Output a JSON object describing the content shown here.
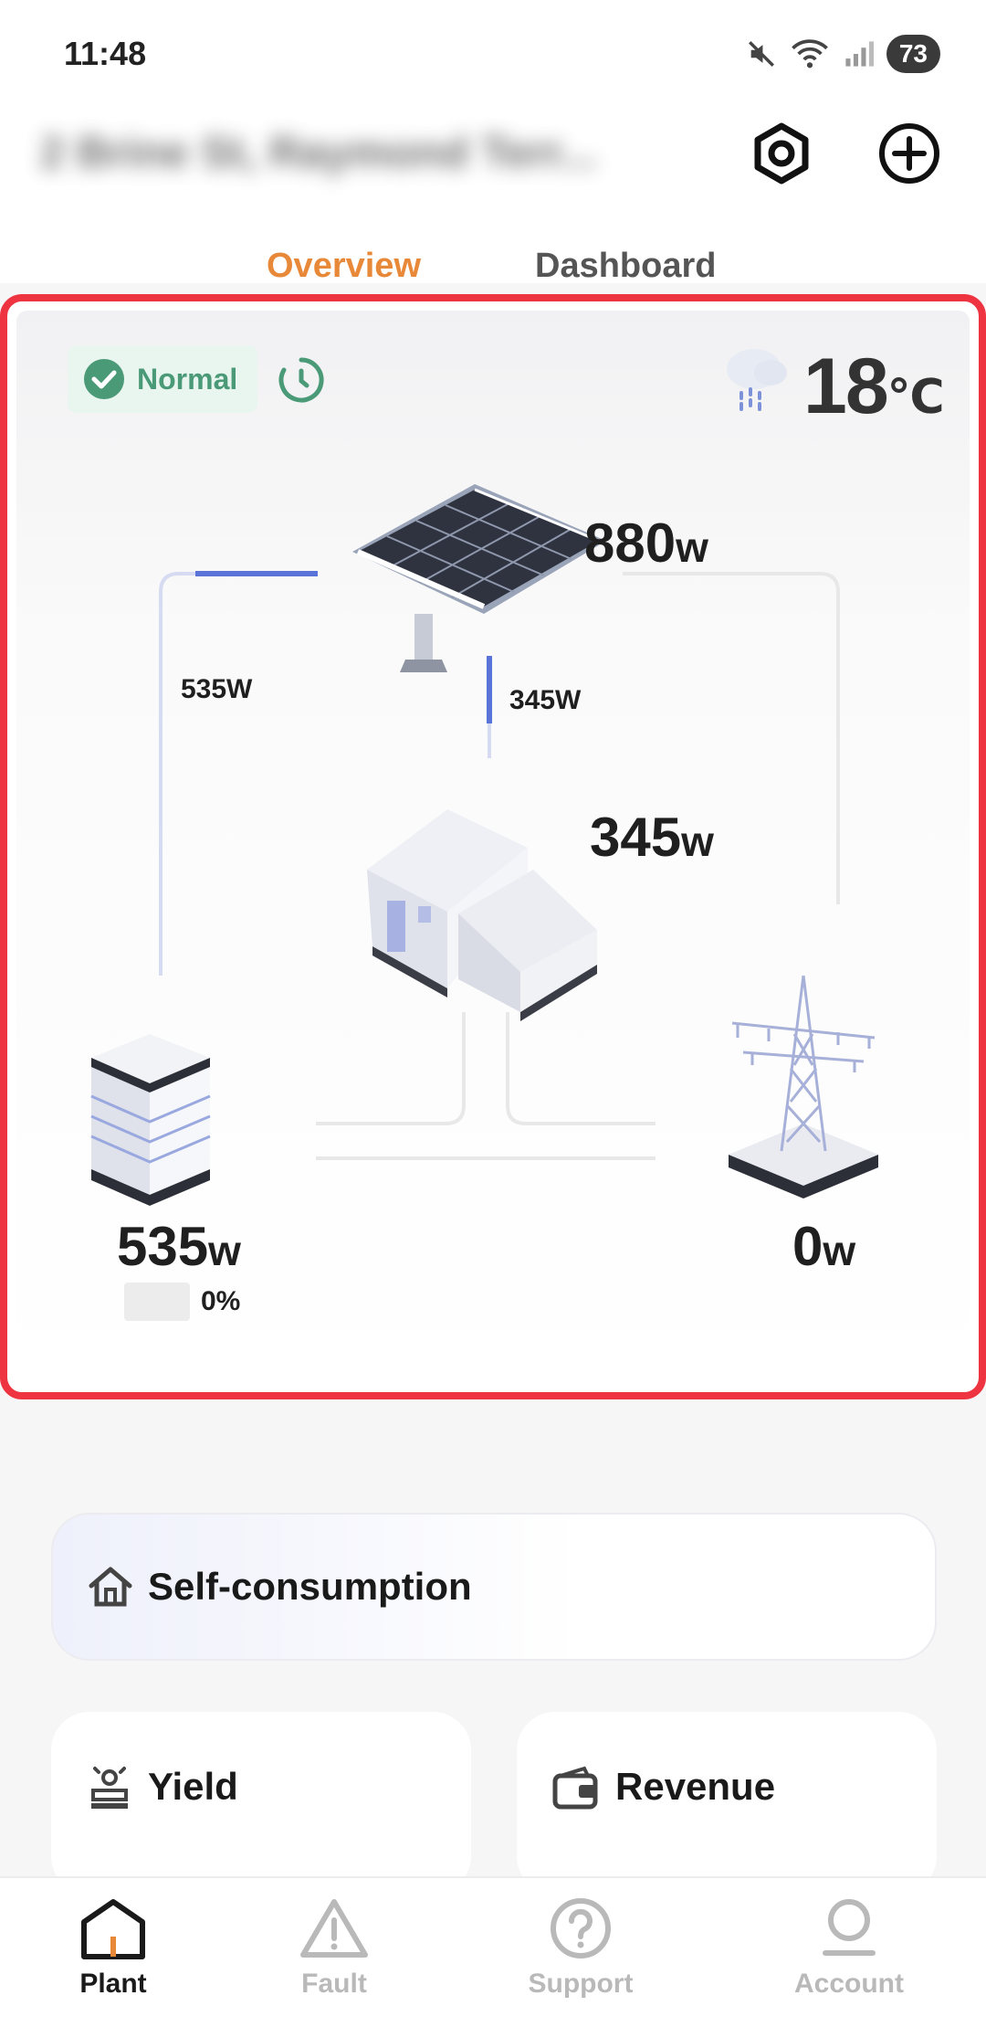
{
  "status_bar": {
    "time": "11:48",
    "battery": "73"
  },
  "header": {
    "plant_name": "2 Brine St, Raymond Terr...",
    "settings_icon": "hexagon-settings-icon",
    "add_icon": "plus-circle-icon"
  },
  "tabs": [
    {
      "label": "Overview",
      "active": true
    },
    {
      "label": "Dashboard",
      "active": false
    }
  ],
  "flow": {
    "status_label": "Normal",
    "weather_icon": "rain-cloud-icon",
    "temperature": "18",
    "temperature_unit": "℃",
    "solar": {
      "value": "880",
      "unit": "w"
    },
    "home": {
      "value": "345",
      "unit": "w"
    },
    "battery": {
      "value": "535",
      "unit": "w",
      "soc": "0%"
    },
    "grid": {
      "value": "0",
      "unit": "w"
    },
    "line_solar_to_battery": "535W",
    "line_solar_to_home": "345W",
    "colors": {
      "accent": "#e8893a",
      "flow_active": "#5a73d8",
      "status_green": "#4a9a78"
    }
  },
  "cards": {
    "self_consumption": "Self-consumption",
    "yield": "Yield",
    "revenue": "Revenue"
  },
  "nav": [
    {
      "label": "Plant",
      "active": true,
      "icon": "house-icon"
    },
    {
      "label": "Fault",
      "active": false,
      "icon": "warning-triangle-icon"
    },
    {
      "label": "Support",
      "active": false,
      "icon": "question-circle-icon"
    },
    {
      "label": "Account",
      "active": false,
      "icon": "user-icon"
    }
  ]
}
